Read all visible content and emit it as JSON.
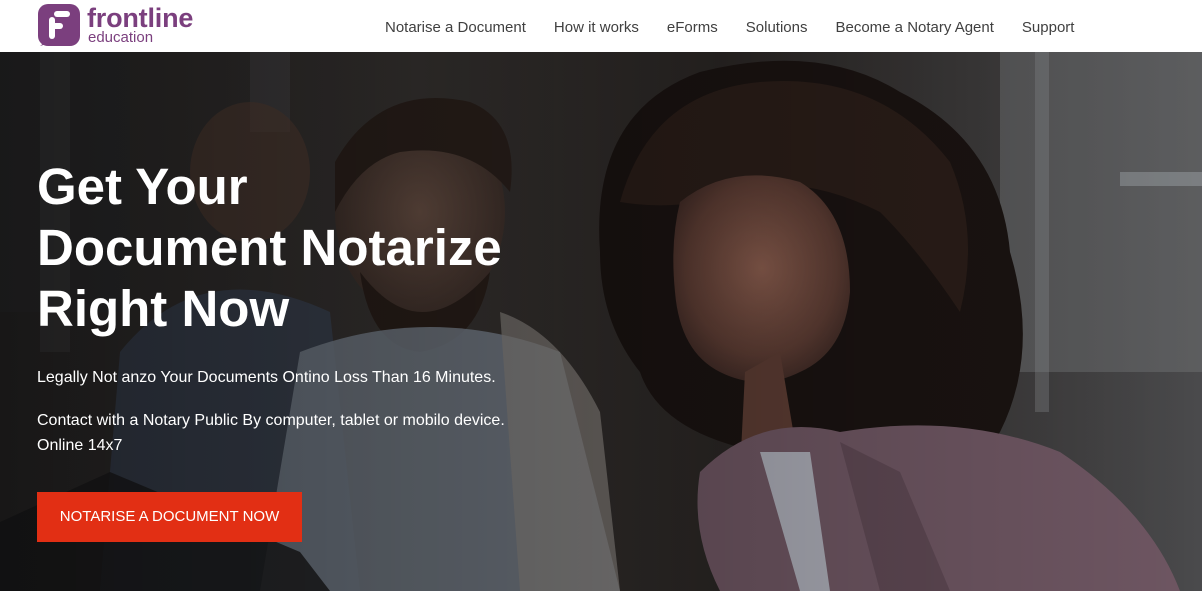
{
  "brand": {
    "name": "frontline",
    "tagline": "education",
    "logo_icon": "frontline-f-icon",
    "color": "#7b3f7e"
  },
  "nav": {
    "items": [
      {
        "label": "Notarise a Document"
      },
      {
        "label": "How it works"
      },
      {
        "label": "eForms"
      },
      {
        "label": "Solutions"
      },
      {
        "label": "Become a Notary Agent"
      },
      {
        "label": "Support"
      }
    ]
  },
  "hero": {
    "title_lines": [
      "Get Your",
      "Document Notarize",
      "Right Now"
    ],
    "paragraph1": "Legally Not anzo Your Documents Ontino Loss Than 16 Minutes.",
    "paragraph2_lines": [
      "Contact with a Notary Public By computer, tablet or mobilo device.",
      "Online 14x7"
    ],
    "cta_label": "NOTARISE A DOCUMENT NOW",
    "cta_color": "#e22f14"
  }
}
